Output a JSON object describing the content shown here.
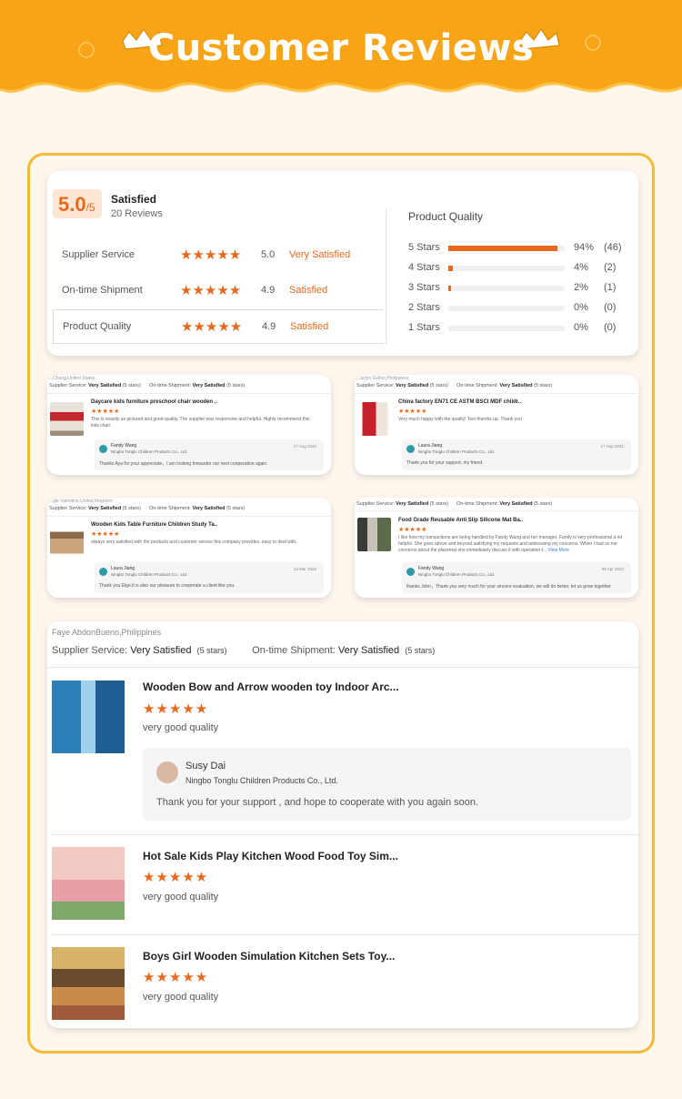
{
  "banner": {
    "title": "Customer Reviews"
  },
  "summary": {
    "score": "5.0",
    "score_max": "/5",
    "satisfaction": "Satisfied",
    "review_count": "20 Reviews",
    "ratings": [
      {
        "label": "Supplier Service",
        "stars": "★★★★★",
        "value": "5.0",
        "text": "Very Satisfied"
      },
      {
        "label": "On-time Shipment",
        "stars": "★★★★★",
        "value": "4.9",
        "text": "Satisfied"
      },
      {
        "label": "Product Quality",
        "stars": "★★★★★",
        "value": "4.9",
        "text": "Satisfied"
      }
    ],
    "quality_title": "Product Quality",
    "distribution": [
      {
        "label": "5 Stars",
        "percent": 94,
        "percent_text": "94%",
        "count": "(46)"
      },
      {
        "label": "4 Stars",
        "percent": 4,
        "percent_text": "4%",
        "count": "(2)"
      },
      {
        "label": "3 Stars",
        "percent": 2,
        "percent_text": "2%",
        "count": "(1)"
      },
      {
        "label": "2 Stars",
        "percent": 0,
        "percent_text": "0%",
        "count": "(0)"
      },
      {
        "label": "1 Stars",
        "percent": 0,
        "percent_text": "0%",
        "count": "(0)"
      }
    ]
  },
  "mini_reviews": [
    {
      "location": "...Chung,United States",
      "supplier_label": "Supplier Service:",
      "supplier_value": "Very Satisfied",
      "supplier_stars": "(5 stars)",
      "shipment_label": "On-time Shipment:",
      "shipment_value": "Very Satisfied",
      "shipment_stars": "(5 stars)",
      "product": "Daycare kids furniture preschool chair wooden ..",
      "stars": "★★★★★",
      "text": "This is exactly as pictured and good quality. The supplier was responsive and helpful. Highly recommend this kids chair.",
      "reply_name": "Fandy Wang",
      "reply_company": "Ningbo Tonglu Children Products Co., Ltd.",
      "reply_date": "17 Aug 2022",
      "reply_text": "Thanks Aya for your appreciate，I am looking forwarder our next cooperation again"
    },
    {
      "location": "...aolyn Gullen,Philippines",
      "supplier_label": "Supplier Service:",
      "supplier_value": "Very Satisfied",
      "supplier_stars": "(5 stars)",
      "shipment_label": "On-time Shipment:",
      "shipment_value": "Very Satisfied",
      "shipment_stars": "(5 stars)",
      "product": "China factory EN71 CE ASTM BSCI MDF childr..",
      "stars": "★★★★★",
      "text": "Very much happy with the quality! Two thumbs up. Thank you",
      "reply_name": "Laura Jiang",
      "reply_company": "Ningbo Tonglu Children Products Co., Ltd.",
      "reply_date": "17 Sep 2021",
      "reply_text": "Thank you for your support, my friend."
    },
    {
      "location": "...gle Valentine,United Kingdom",
      "supplier_label": "Supplier Service:",
      "supplier_value": "Very Satisfied",
      "supplier_stars": "(5 stars)",
      "shipment_label": "On-time Shipment:",
      "shipment_value": "Very Satisfied",
      "shipment_stars": "(5 stars)",
      "product": "Wooden Kids Table Furniture Children Study Ta..",
      "stars": "★★★★★",
      "text": "always very satisfied with the products and customer service this company provides. easy to deal with.",
      "reply_name": "Laura Jiang",
      "reply_company": "Ningbo Tonglu Children Products Co., Ltd.",
      "reply_date": "13 Mar 2022",
      "reply_text": "Thank you Elge,it is also our pleasure to cooperate a client like you."
    },
    {
      "location": "",
      "supplier_label": "Supplier Service:",
      "supplier_value": "Very Satisfied",
      "supplier_stars": "(5 stars)",
      "shipment_label": "On-time Shipment:",
      "shipment_value": "Very Satisfied",
      "shipment_stars": "(5 stars)",
      "product": "Food Grade Reusable Anti Slip Silicone Mat Ba..",
      "stars": "★★★★★",
      "text": "I like how my transactions are being handled by Fandy Wang and her manager. Fandy is very professional a nd helpful. She goes above and beyond satisfying my requests and addressing my concerns. When I had so me concerns about the placemat she immediately discuss it with operation t...",
      "more": "View More",
      "reply_name": "Fandy Wang",
      "reply_company": "Ningbo Tonglu Children Products Co., Ltd.",
      "reply_date": "06 Apr 2022",
      "reply_text": "thanks John，Thank you very much for your sincere evaluation, we will do better, let us grow together"
    }
  ],
  "big_review": {
    "location": "Faye AbdonBueno,Philippines",
    "supplier_label": "Supplier Service:",
    "supplier_value": "Very Satisfied",
    "supplier_stars": "(5 stars)",
    "shipment_label": "On-time Shipment:",
    "shipment_value": "Very Satisfied",
    "shipment_stars": "(5 stars)",
    "items": [
      {
        "product": "Wooden Bow and Arrow wooden toy Indoor Arc...",
        "stars": "★★★★★",
        "text": "very good quality"
      },
      {
        "product": "Hot Sale Kids Play Kitchen Wood Food Toy Sim...",
        "stars": "★★★★★",
        "text": "very good quality"
      },
      {
        "product": "Boys Girl Wooden Simulation Kitchen Sets Toy...",
        "stars": "★★★★★",
        "text": "very good quality"
      }
    ],
    "reply_name": "Susy Dai",
    "reply_company": "Ningbo Tonglu Children Products Co., Ltd.",
    "reply_text": "Thank you for your support , and hope to cooperate with you again soon."
  },
  "colors": {
    "accent": "#e8691b",
    "banner": "#f7a516",
    "frame": "#f6b935",
    "background": "#fdf6ea"
  }
}
